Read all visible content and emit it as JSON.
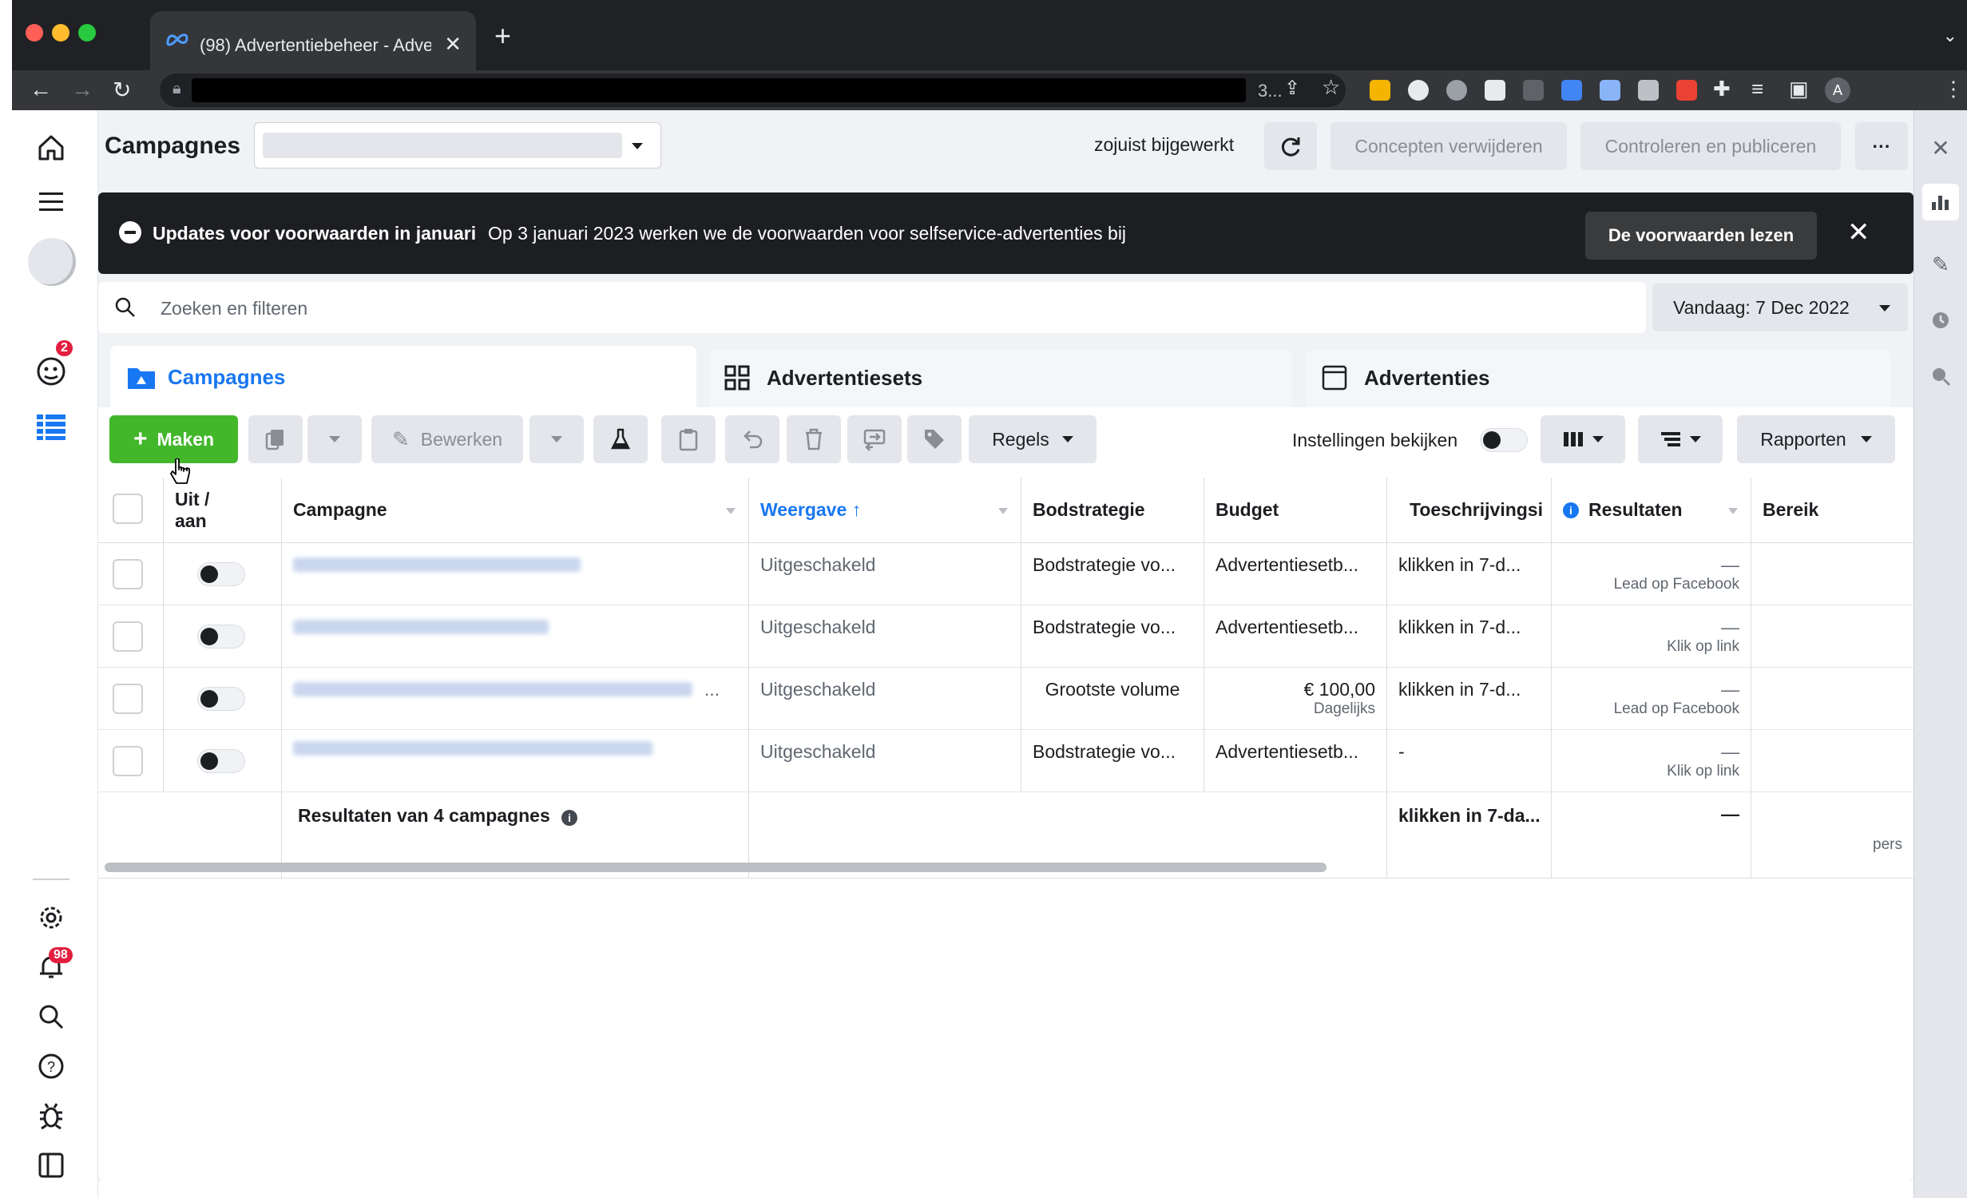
{
  "browser": {
    "tab_title": "(98) Advertentiebeheer - Adve",
    "new_tab": "+",
    "tab_close": "✕",
    "omnibox_tail": "3...",
    "profile_initial": "A"
  },
  "header": {
    "title": "Campagnes",
    "status": "zojuist bijgewerkt",
    "discard_drafts": "Concepten verwijderen",
    "review_publish": "Controleren en publiceren",
    "more": "···"
  },
  "banner": {
    "title": "Updates voor voorwaarden in januari",
    "text": "Op 3 januari 2023 werken we de voorwaarden voor selfservice-advertenties bij",
    "button": "De voorwaarden lezen",
    "close": "✕"
  },
  "search": {
    "placeholder": "Zoeken en filteren",
    "date": "Vandaag: 7 Dec 2022"
  },
  "tabs": [
    {
      "label": "Campagnes"
    },
    {
      "label": "Advertentiesets"
    },
    {
      "label": "Advertenties"
    }
  ],
  "toolbar": {
    "create": "Maken",
    "edit": "Bewerken",
    "rules": "Regels",
    "view_settings": "Instellingen bekijken",
    "reports": "Rapporten"
  },
  "table": {
    "headers": {
      "onoff": "Uit / aan",
      "campaign": "Campagne",
      "delivery": "Weergave ↑",
      "bid": "Bodstrategie",
      "budget": "Budget",
      "attribution": "Toeschrijvingsi",
      "results": "Resultaten",
      "reach": "Bereik"
    },
    "rows": [
      {
        "delivery": "Uitgeschakeld",
        "bid": "Bodstrategie vo...",
        "budget": "Advertentiesetb...",
        "budget_sub": "",
        "attribution": "klikken in 7-d...",
        "results": "—",
        "results_sub": "Lead op Facebook"
      },
      {
        "delivery": "Uitgeschakeld",
        "bid": "Bodstrategie vo...",
        "budget": "Advertentiesetb...",
        "budget_sub": "",
        "attribution": "klikken in 7-d...",
        "results": "—",
        "results_sub": "Klik op link"
      },
      {
        "delivery": "Uitgeschakeld",
        "bid": "Grootste volume",
        "budget": "€ 100,00",
        "budget_sub": "Dagelijks",
        "attribution": "klikken in 7-d...",
        "results": "—",
        "results_sub": "Lead op Facebook"
      },
      {
        "delivery": "Uitgeschakeld",
        "bid": "Bodstrategie vo...",
        "budget": "Advertentiesetb...",
        "budget_sub": "",
        "attribution": "-",
        "results": "—",
        "results_sub": "Klik op link"
      }
    ],
    "row3_more": "...",
    "summary": {
      "label": "Resultaten van 4 campagnes",
      "attribution": "klikken in 7-da...",
      "results": "—",
      "reach_sub": "pers"
    }
  },
  "leftnav": {
    "notifications_badge": "2",
    "alerts_badge": "98"
  },
  "colors": {
    "accent": "#1877f2",
    "create_green": "#42b72a",
    "banner_bg": "#1c1e21",
    "badge_red": "#e41e3f"
  }
}
